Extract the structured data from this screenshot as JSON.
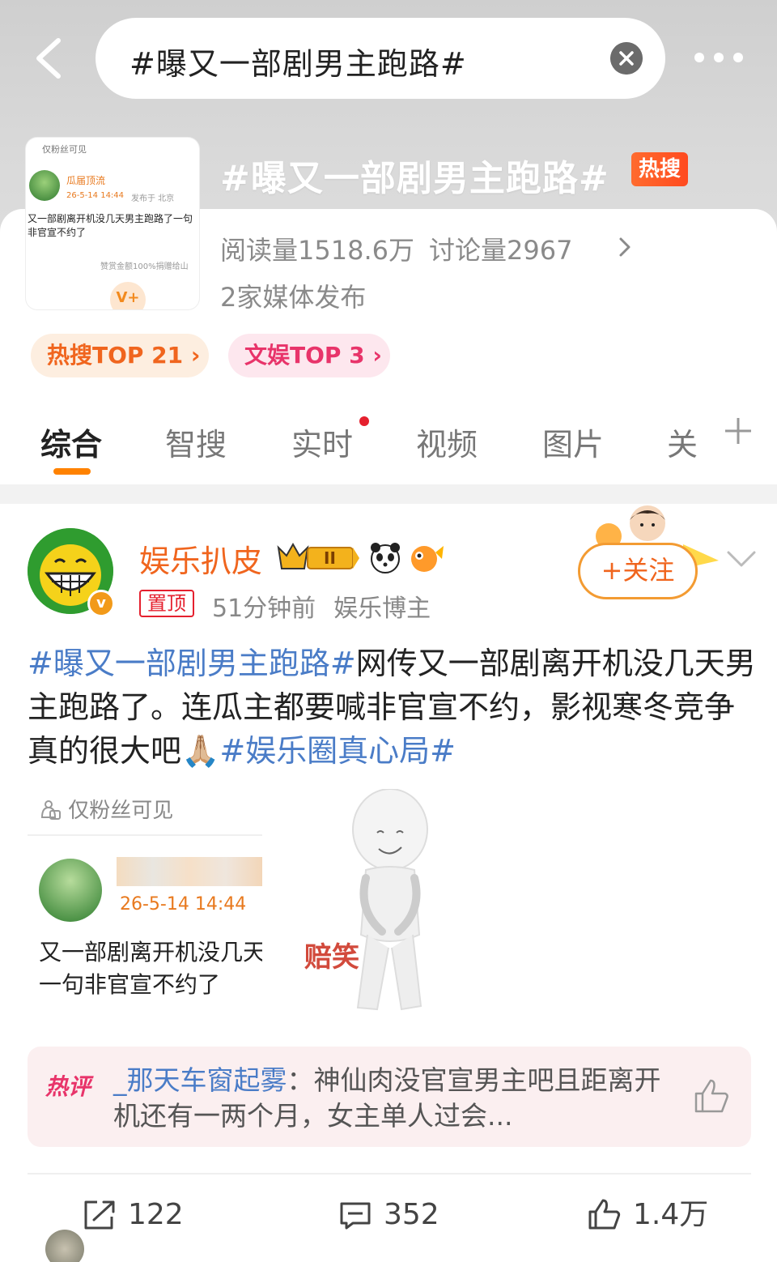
{
  "search": {
    "query": "#曝又一部剧男主跑路#"
  },
  "topic": {
    "title": "#曝又一部剧男主跑路#",
    "hot_badge": "热搜",
    "reads": "阅读量1518.6万",
    "discussions": "讨论量2967",
    "media": "2家媒体发布",
    "rank_hot": "热搜TOP 21 ›",
    "rank_ent": "文娱TOP 3 ›"
  },
  "thumbnail": {
    "fans_only": "仅粉丝可见",
    "name": "瓜届顶流",
    "time": "26-5-14 14:44",
    "location": "发布于 北京",
    "text": "又一部剧离开机没几天男主跑路了一句非官宣不约了",
    "tip": "赞赏金额100%捐赠给山",
    "v_label": "V+"
  },
  "tabs": [
    {
      "label": "综合"
    },
    {
      "label": "智搜"
    },
    {
      "label": "实时"
    },
    {
      "label": "视频"
    },
    {
      "label": "图片"
    },
    {
      "label": "关"
    }
  ],
  "post": {
    "username": "娱乐扒皮",
    "level_badge": "II",
    "pin_label": "置顶",
    "time": "51分钟前",
    "role": "娱乐博主",
    "follow_label": "+关注",
    "text_tag1": "#曝又一部剧男主跑路#",
    "text_body": "网传又一部剧离开机没几天男主跑路了。连瓜主都要喊非官宣不约，影视寒冬竞争真的很大吧🙏🏼",
    "text_tag2": "#娱乐圈真心局#",
    "embed": {
      "fans_only": "仅粉丝可见",
      "time": "26-5-14 14:44",
      "text_line1": "又一部剧离开机没几天",
      "text_line2": "一句非官宣不约了"
    },
    "meme_label": "赔笑",
    "hot_comment": {
      "label": "热评",
      "user": "_那天车窗起雾",
      "text": "：神仙肉没官宣男主吧且距离开机还有一两个月，女主单人过会..."
    },
    "actions": {
      "share": "122",
      "comment": "352",
      "like": "1.4万"
    }
  },
  "colors": {
    "accent": "#ff8200",
    "link": "#4a7cc7",
    "username": "#f0651e",
    "hot": "#e8346a"
  }
}
